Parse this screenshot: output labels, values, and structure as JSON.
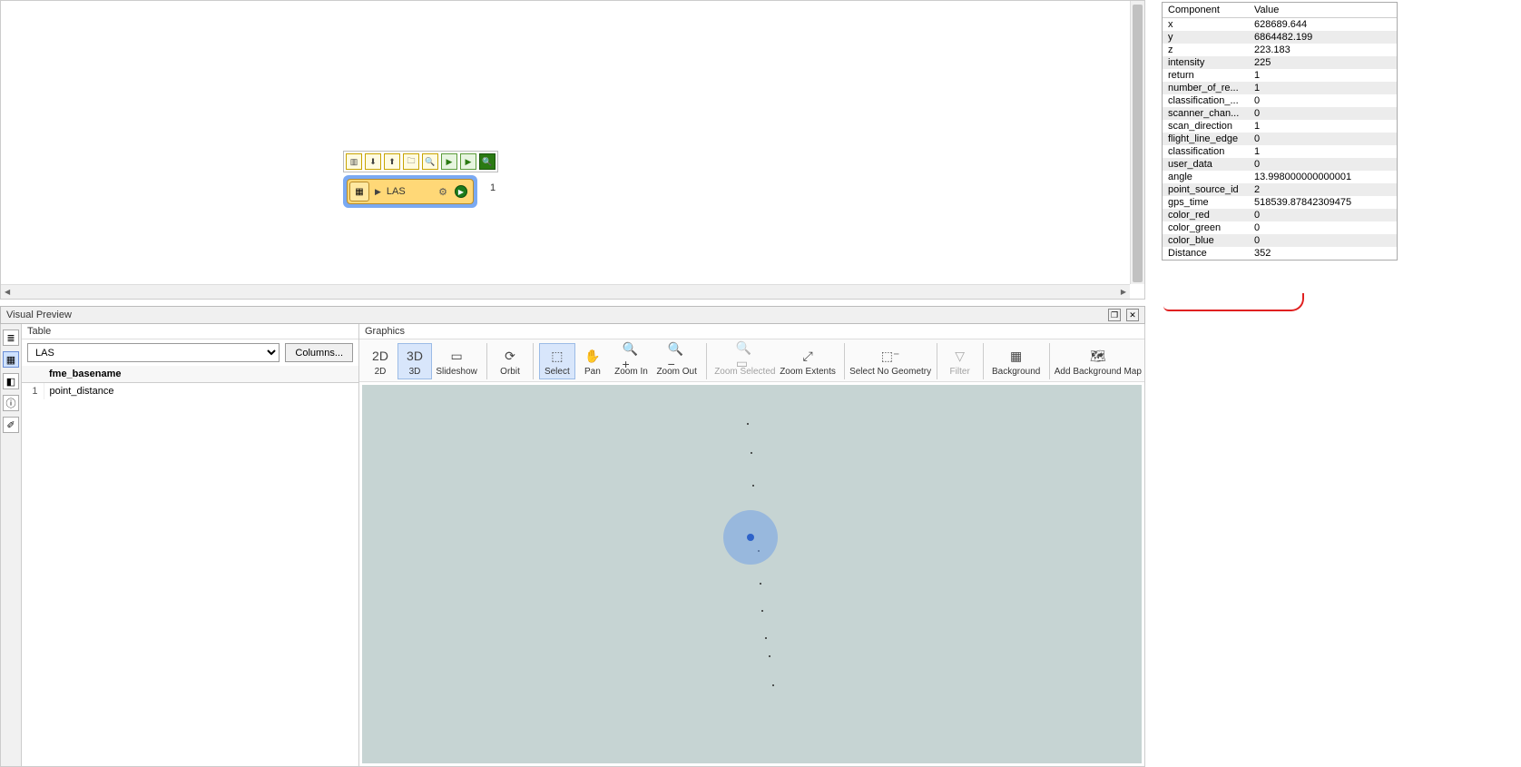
{
  "canvas": {
    "node_label": "LAS",
    "node_feature_count": "1",
    "mini_toolbar_icons": [
      "open",
      "import",
      "export",
      "folder",
      "zoom-find",
      "run",
      "run-step",
      "inspect"
    ]
  },
  "visual_preview": {
    "title": "Visual Preview"
  },
  "table": {
    "header": "Table",
    "dropdown_options": [
      "LAS"
    ],
    "selected": "LAS",
    "columns_button": "Columns...",
    "col_header": "fme_basename",
    "rows": [
      {
        "n": "1",
        "v": "point_distance"
      }
    ]
  },
  "graphics": {
    "header": "Graphics",
    "buttons": [
      {
        "id": "2d",
        "label": "2D"
      },
      {
        "id": "3d",
        "label": "3D",
        "active": true
      },
      {
        "id": "slide",
        "label": "Slideshow"
      },
      {
        "id": "orbit",
        "label": "Orbit"
      },
      {
        "id": "select",
        "label": "Select",
        "active": true
      },
      {
        "id": "pan",
        "label": "Pan"
      },
      {
        "id": "zin",
        "label": "Zoom In"
      },
      {
        "id": "zout",
        "label": "Zoom Out"
      },
      {
        "id": "zsel",
        "label": "Zoom Selected",
        "disabled": true
      },
      {
        "id": "zext",
        "label": "Zoom Extents"
      },
      {
        "id": "nogeom",
        "label": "Select No Geometry"
      },
      {
        "id": "filter",
        "label": "Filter",
        "disabled": true
      },
      {
        "id": "bg",
        "label": "Background"
      },
      {
        "id": "addbg",
        "label": "Add Background Map"
      }
    ]
  },
  "inspector": {
    "col1": "Component",
    "col2": "Value",
    "rows": [
      {
        "k": "x",
        "v": "628689.644"
      },
      {
        "k": "y",
        "v": "6864482.199"
      },
      {
        "k": "z",
        "v": "223.183"
      },
      {
        "k": "intensity",
        "v": "225"
      },
      {
        "k": "return",
        "v": "1"
      },
      {
        "k": "number_of_re...",
        "v": "1"
      },
      {
        "k": "classification_...",
        "v": "0"
      },
      {
        "k": "scanner_chan...",
        "v": "0"
      },
      {
        "k": "scan_direction",
        "v": "1"
      },
      {
        "k": "flight_line_edge",
        "v": "0"
      },
      {
        "k": "classification",
        "v": "1"
      },
      {
        "k": "user_data",
        "v": "0"
      },
      {
        "k": "angle",
        "v": "13.998000000000001"
      },
      {
        "k": "point_source_id",
        "v": "2"
      },
      {
        "k": "gps_time",
        "v": "518539.87842309475"
      },
      {
        "k": "color_red",
        "v": "0"
      },
      {
        "k": "color_green",
        "v": "0"
      },
      {
        "k": "color_blue",
        "v": "0"
      },
      {
        "k": "Distance",
        "v": "352"
      }
    ]
  }
}
